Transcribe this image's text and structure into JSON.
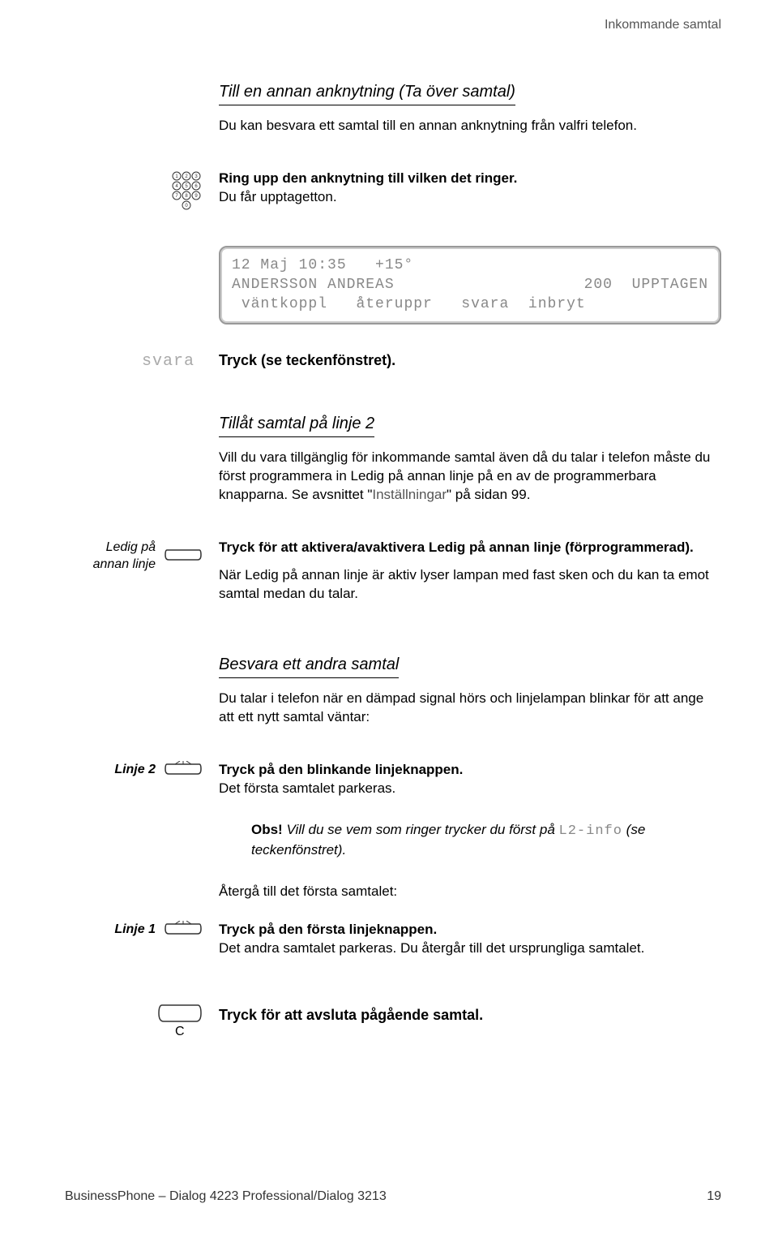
{
  "header": {
    "section_name": "Inkommande samtal"
  },
  "s1": {
    "heading": "Till en annan anknytning (Ta över samtal)",
    "intro": "Du kan besvara ett samtal till en annan anknytning från valfri telefon.",
    "ring_bold": "Ring upp den anknytning till vilken det ringer.",
    "ring_after": "Du får upptagetton."
  },
  "display": {
    "line1_left": "12 Maj 10:35",
    "line1_right": "+15°",
    "line2_name": "ANDERSSON ANDREAS",
    "line2_ext": "200",
    "line2_status": "UPPTAGEN",
    "soft1": "väntkoppl",
    "soft2": " återuppr",
    "soft3": "svara",
    "soft4": "inbryt"
  },
  "svara": {
    "label": "svara",
    "bold": "Tryck (se teckenfönstret)."
  },
  "s2": {
    "heading": "Tillåt samtal på linje 2",
    "p1a": "Vill du vara tillgänglig för inkommande samtal även då du talar i telefon måste du först programmera in Ledig på annan linje på en av de programmerbara knapparna. Se avsnittet \"",
    "p1link": "Inställningar",
    "p1b": "\" på sidan 99."
  },
  "ledig": {
    "label1": "Ledig på",
    "label2": "annan linje",
    "bold": "Tryck för att aktivera/avaktivera Ledig på annan linje (förprogrammerad).",
    "after": "När Ledig på annan linje är aktiv lyser lampan med fast sken och du kan ta emot samtal medan du talar."
  },
  "s3": {
    "heading": "Besvara ett andra samtal",
    "intro": "Du talar i telefon när en dämpad signal hörs och linjelampan blinkar för att ange att ett nytt samtal väntar:"
  },
  "linje2": {
    "label": "Linje 2",
    "bold": "Tryck på den blinkande linjeknappen.",
    "after": "Det första samtalet parkeras."
  },
  "obs": {
    "prefix": "Obs!",
    "text_a": "Vill du se vem som ringer trycker du först på ",
    "code": "L2-info",
    "text_b": " (se teckenfönstret)."
  },
  "back": {
    "text": "Återgå till det första samtalet:"
  },
  "linje1": {
    "label": "Linje 1",
    "bold": "Tryck på den första linjeknappen.",
    "after": "Det andra samtalet parkeras. Du återgår till det ursprungliga samtalet."
  },
  "cbtn": {
    "label": "C",
    "bold": "Tryck för att avsluta pågående samtal."
  },
  "footer": {
    "left": "BusinessPhone – Dialog 4223 Professional/Dialog 3213",
    "page": "19"
  }
}
